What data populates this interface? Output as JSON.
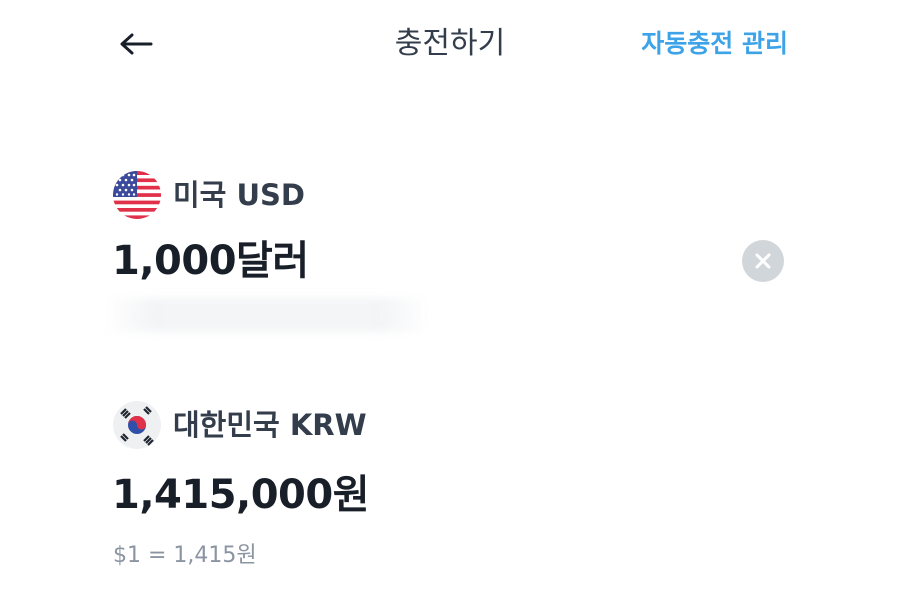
{
  "header": {
    "title": "충전하기",
    "auto_charge_label": "자동충전 관리"
  },
  "source": {
    "flag_icon": "us-flag-icon",
    "currency_name": "미국 USD",
    "amount": "1,000달러"
  },
  "target": {
    "flag_icon": "kr-flag-icon",
    "currency_name": "대한민국 KRW",
    "amount": "1,415,000원"
  },
  "exchange_rate": "$1 = 1,415원",
  "colors": {
    "accent": "#3ca3e8",
    "text_primary": "#191f28",
    "text_secondary": "#8b95a1",
    "clear_button": "#d1d6db"
  }
}
